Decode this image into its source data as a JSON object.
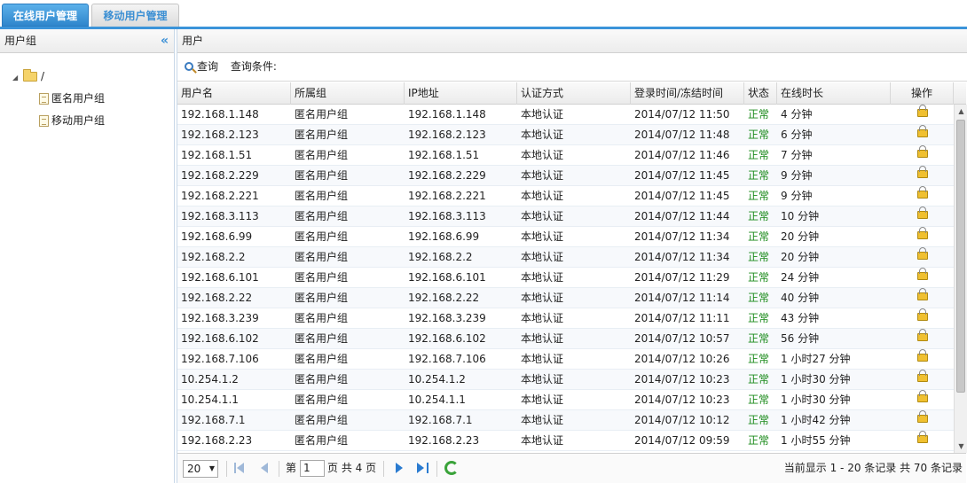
{
  "tabs": [
    {
      "label": "在线用户管理"
    },
    {
      "label": "移动用户管理"
    }
  ],
  "left": {
    "title": "用户组",
    "tree": {
      "root": "/",
      "children": [
        "匿名用户组",
        "移动用户组"
      ]
    }
  },
  "right": {
    "title": "用户",
    "toolbar": {
      "query": "查询",
      "condition": "查询条件:"
    },
    "columns": [
      "用户名",
      "所属组",
      "IP地址",
      "认证方式",
      "登录时间/冻结时间",
      "状态",
      "在线时长",
      "操作"
    ],
    "rows": [
      [
        "192.168.1.148",
        "匿名用户组",
        "192.168.1.148",
        "本地认证",
        "2014/07/12 11:50",
        "正常",
        "4 分钟"
      ],
      [
        "192.168.2.123",
        "匿名用户组",
        "192.168.2.123",
        "本地认证",
        "2014/07/12 11:48",
        "正常",
        "6 分钟"
      ],
      [
        "192.168.1.51",
        "匿名用户组",
        "192.168.1.51",
        "本地认证",
        "2014/07/12 11:46",
        "正常",
        "7 分钟"
      ],
      [
        "192.168.2.229",
        "匿名用户组",
        "192.168.2.229",
        "本地认证",
        "2014/07/12 11:45",
        "正常",
        "9 分钟"
      ],
      [
        "192.168.2.221",
        "匿名用户组",
        "192.168.2.221",
        "本地认证",
        "2014/07/12 11:45",
        "正常",
        "9 分钟"
      ],
      [
        "192.168.3.113",
        "匿名用户组",
        "192.168.3.113",
        "本地认证",
        "2014/07/12 11:44",
        "正常",
        "10 分钟"
      ],
      [
        "192.168.6.99",
        "匿名用户组",
        "192.168.6.99",
        "本地认证",
        "2014/07/12 11:34",
        "正常",
        "20 分钟"
      ],
      [
        "192.168.2.2",
        "匿名用户组",
        "192.168.2.2",
        "本地认证",
        "2014/07/12 11:34",
        "正常",
        "20 分钟"
      ],
      [
        "192.168.6.101",
        "匿名用户组",
        "192.168.6.101",
        "本地认证",
        "2014/07/12 11:29",
        "正常",
        "24 分钟"
      ],
      [
        "192.168.2.22",
        "匿名用户组",
        "192.168.2.22",
        "本地认证",
        "2014/07/12 11:14",
        "正常",
        "40 分钟"
      ],
      [
        "192.168.3.239",
        "匿名用户组",
        "192.168.3.239",
        "本地认证",
        "2014/07/12 11:11",
        "正常",
        "43 分钟"
      ],
      [
        "192.168.6.102",
        "匿名用户组",
        "192.168.6.102",
        "本地认证",
        "2014/07/12 10:57",
        "正常",
        "56 分钟"
      ],
      [
        "192.168.7.106",
        "匿名用户组",
        "192.168.7.106",
        "本地认证",
        "2014/07/12 10:26",
        "正常",
        "1 小时27 分钟"
      ],
      [
        "10.254.1.2",
        "匿名用户组",
        "10.254.1.2",
        "本地认证",
        "2014/07/12 10:23",
        "正常",
        "1 小时30 分钟"
      ],
      [
        "10.254.1.1",
        "匿名用户组",
        "10.254.1.1",
        "本地认证",
        "2014/07/12 10:23",
        "正常",
        "1 小时30 分钟"
      ],
      [
        "192.168.7.1",
        "匿名用户组",
        "192.168.7.1",
        "本地认证",
        "2014/07/12 10:12",
        "正常",
        "1 小时42 分钟"
      ],
      [
        "192.168.2.23",
        "匿名用户组",
        "192.168.2.23",
        "本地认证",
        "2014/07/12 09:59",
        "正常",
        "1 小时55 分钟"
      ]
    ],
    "pager": {
      "page_size": "20",
      "page_prefix": "第",
      "page_value": "1",
      "page_suffix": "页 共 4 页",
      "summary": "当前显示 1 - 20 条记录 共 70 条记录"
    }
  },
  "icons": {
    "search": "search-icon",
    "folder": "folder-icon",
    "document": "document-icon",
    "lock": "lock-icon",
    "refresh": "refresh-icon",
    "collapse": "double-chevron-left-icon"
  },
  "colors": {
    "accent": "#3b94d9",
    "status_ok": "#1a8a1a"
  }
}
